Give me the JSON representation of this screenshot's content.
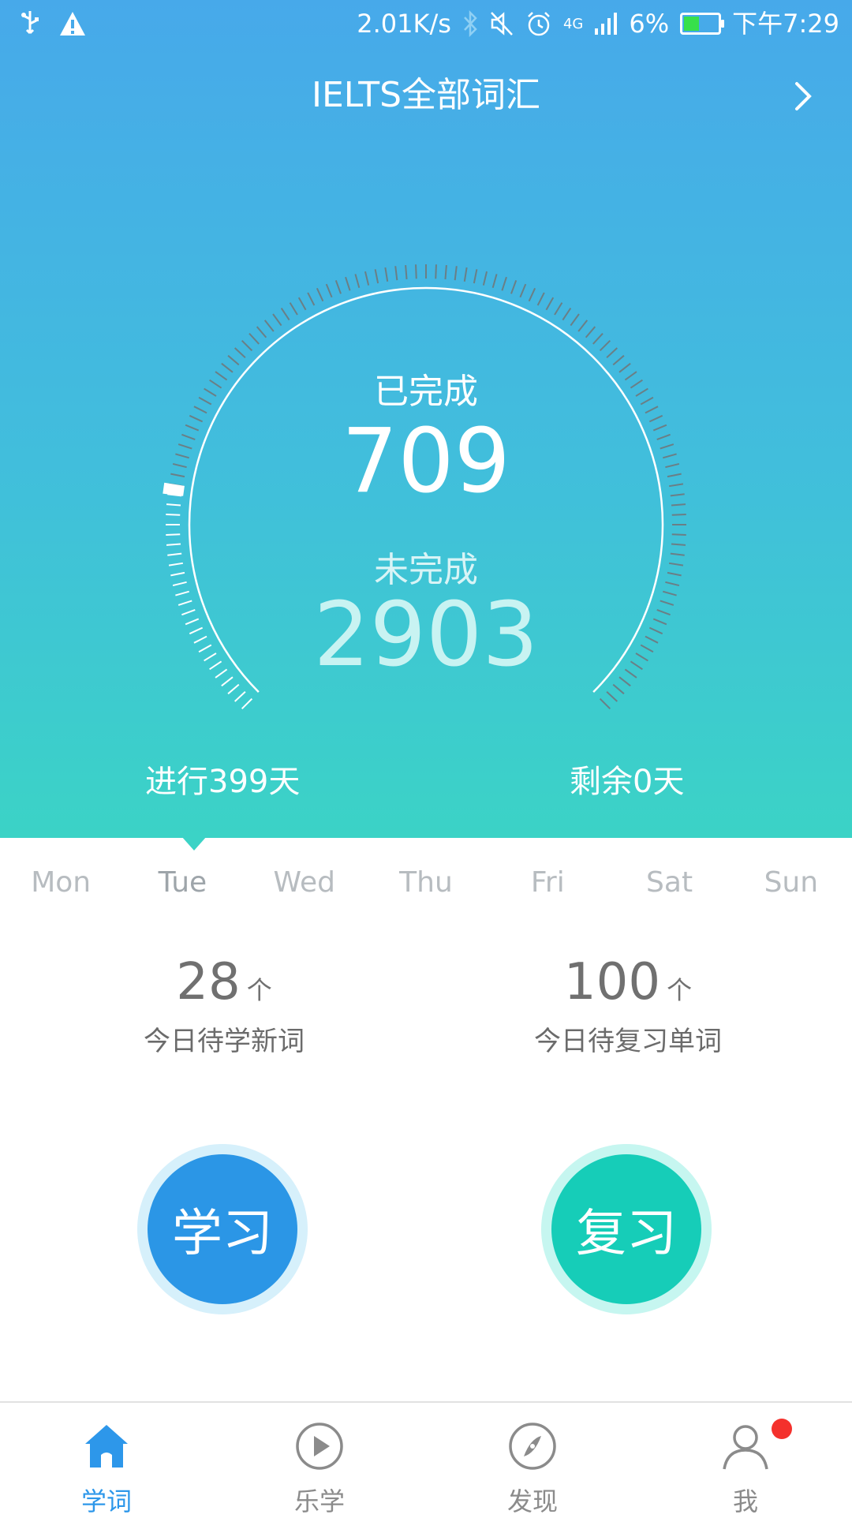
{
  "status_bar": {
    "net_speed": "2.01K/s",
    "network": "4G",
    "battery": "6%",
    "time": "下午7:29",
    "icons": [
      "usb-icon",
      "warning-icon",
      "bluetooth-icon",
      "mute-icon",
      "alarm-icon",
      "signal-icon",
      "battery-icon"
    ]
  },
  "header": {
    "title": "IELTS全部词汇",
    "chevron": "chevron-right-icon"
  },
  "progress": {
    "completed_label": "已完成",
    "completed": "709",
    "remaining_label": "未完成",
    "remaining": "2903",
    "days_elapsed": "进行399天",
    "days_left": "剩余0天",
    "completed_fraction": 0.196
  },
  "week": {
    "days": [
      "Mon",
      "Tue",
      "Wed",
      "Thu",
      "Fri",
      "Sat",
      "Sun"
    ],
    "current": "Tue"
  },
  "stats": {
    "new_words": {
      "value": "28",
      "unit": "个",
      "label": "今日待学新词"
    },
    "review_words": {
      "value": "100",
      "unit": "个",
      "label": "今日待复习单词"
    }
  },
  "actions": {
    "study": "学习",
    "review": "复习"
  },
  "nav": {
    "items": [
      {
        "label": "学词",
        "icon": "home-icon",
        "active": true
      },
      {
        "label": "乐学",
        "icon": "play-icon",
        "active": false
      },
      {
        "label": "发现",
        "icon": "compass-icon",
        "active": false
      },
      {
        "label": "我",
        "icon": "user-icon",
        "active": false,
        "badge": true
      }
    ]
  },
  "colors": {
    "accent_blue": "#2b96e6",
    "accent_teal": "#16cdb8",
    "badge_red": "#f4312c"
  }
}
